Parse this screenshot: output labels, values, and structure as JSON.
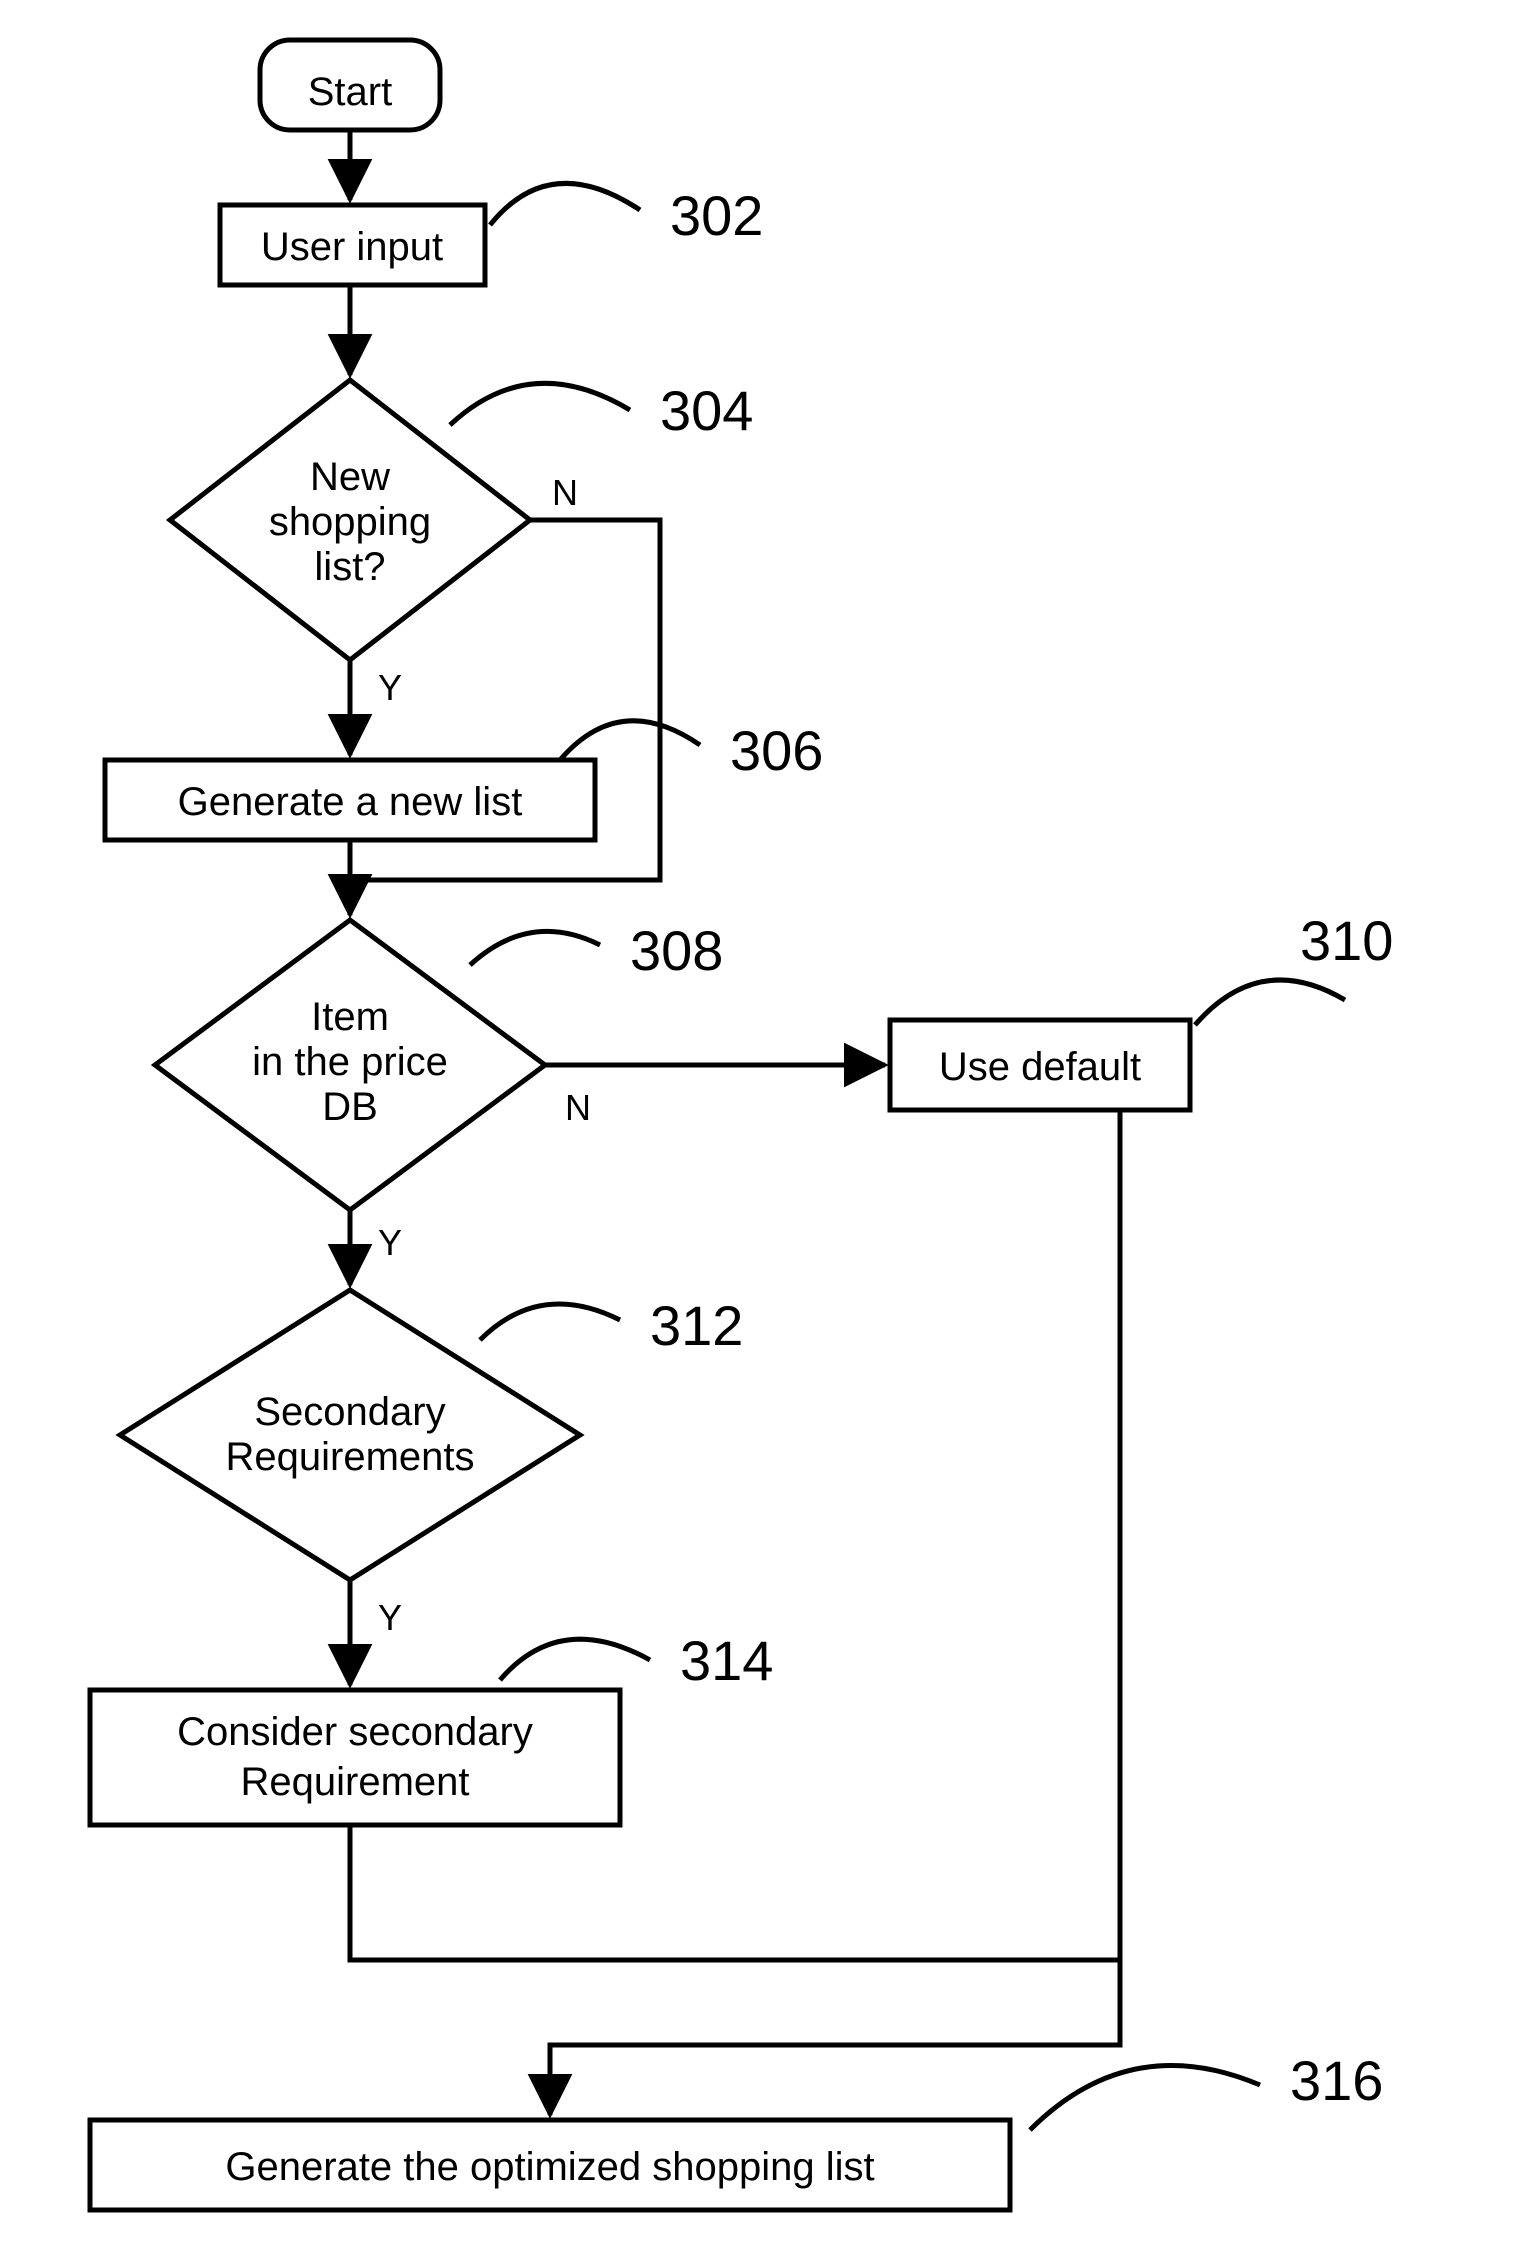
{
  "nodes": {
    "start": {
      "label": "Start"
    },
    "n302": {
      "label": "User input",
      "ref": "302"
    },
    "n304": {
      "lines": [
        "New",
        "shopping",
        "list?"
      ],
      "ref": "304"
    },
    "n306": {
      "label": "Generate a new list",
      "ref": "306"
    },
    "n308": {
      "lines": [
        "Item",
        "in the price",
        "DB"
      ],
      "ref": "308"
    },
    "n310": {
      "label": "Use default",
      "ref": "310"
    },
    "n312": {
      "lines": [
        "Secondary",
        "Requirements"
      ],
      "ref": "312"
    },
    "n314": {
      "lines": [
        "Consider secondary",
        "Requirement"
      ],
      "ref": "314"
    },
    "n316": {
      "label": "Generate the optimized shopping list",
      "ref": "316"
    }
  },
  "edges": {
    "n304_yes": "Y",
    "n304_no": "N",
    "n308_yes": "Y",
    "n308_no": "N",
    "n312_yes": "Y"
  }
}
